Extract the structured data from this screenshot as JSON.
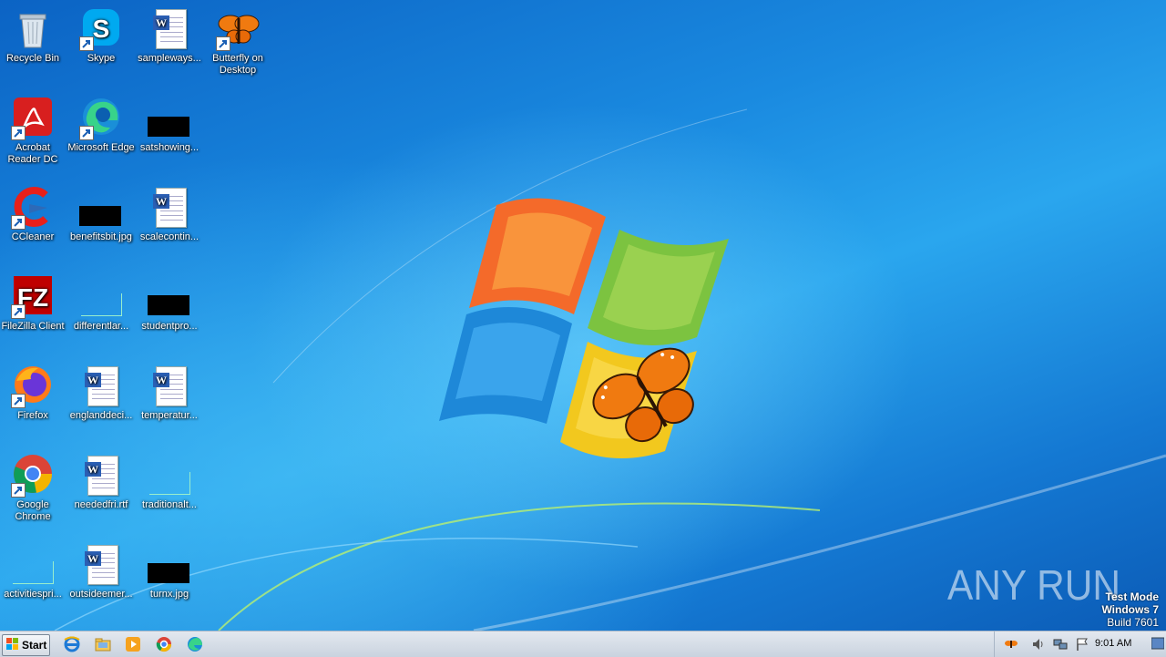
{
  "desktop_icons": [
    {
      "label": "Recycle Bin"
    },
    {
      "label": "Skype"
    },
    {
      "label": "sampleways..."
    },
    {
      "label": "Butterfly on Desktop"
    },
    {
      "label": "Acrobat Reader DC"
    },
    {
      "label": "Microsoft Edge"
    },
    {
      "label": "satshowing..."
    },
    {
      "label": "CCleaner"
    },
    {
      "label": "benefitsbit.jpg"
    },
    {
      "label": "scalecontin..."
    },
    {
      "label": "FileZilla Client"
    },
    {
      "label": "differentlar..."
    },
    {
      "label": "studentpro..."
    },
    {
      "label": "Firefox"
    },
    {
      "label": "englanddeci..."
    },
    {
      "label": "temperatur..."
    },
    {
      "label": "Google Chrome"
    },
    {
      "label": "neededfri.rtf"
    },
    {
      "label": "traditionalt..."
    },
    {
      "label": "activitiespri..."
    },
    {
      "label": "outsideemer..."
    },
    {
      "label": "turnx.jpg"
    }
  ],
  "watermark": {
    "brand": "ANY RUN",
    "line1": "Test Mode",
    "line2": "Windows 7",
    "line3": "Build 7601"
  },
  "taskbar": {
    "start_label": "Start",
    "pinned": [
      "internet-explorer-icon",
      "windows-explorer-icon",
      "media-player-icon",
      "chrome-icon",
      "edge-icon"
    ],
    "clock": "9:01 AM"
  },
  "colors": {
    "wallpaper_blue": "#1a8ae0",
    "taskbar": "#d4dbe4",
    "butterfly_orange": "#f07a10"
  }
}
